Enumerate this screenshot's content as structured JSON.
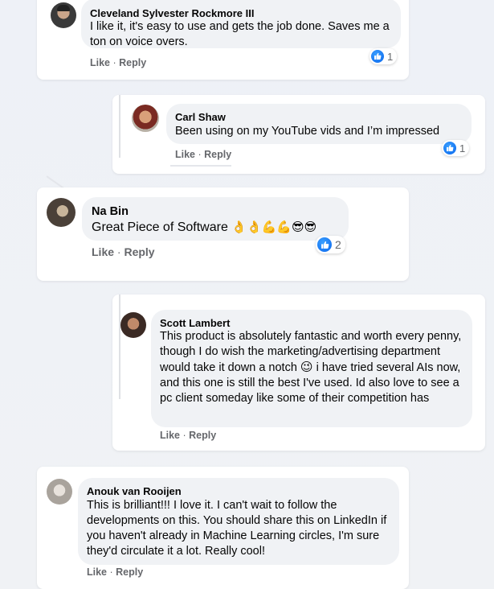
{
  "comments": [
    {
      "name": "Cleveland Sylvester Rockmore III",
      "text": "I like it, it's easy to use and gets the job done. Saves me a ton on voice overs.",
      "like_label": "Like",
      "reply_label": "Reply",
      "reaction_count": "1"
    },
    {
      "name": "Carl Shaw",
      "text": "Been using on my YouTube vids and I’m impressed",
      "like_label": "Like",
      "reply_label": "Reply",
      "reaction_count": "1"
    },
    {
      "name": "Na Bin",
      "text": "Great Piece of Software",
      "emojis": "👌👌💪💪😎😎",
      "like_label": "Like",
      "reply_label": "Reply",
      "reaction_count": "2"
    },
    {
      "name": "Scott Lambert",
      "text_before_emoji": "This product is absolutely fantastic and worth every penny, though I do wish the marketing/advertising department would take it down a notch",
      "emoji": "😉",
      "text_after_emoji": "i have tried several AIs now, and this one is still the best I've used. Id also love to see a pc client someday like some of their competition has",
      "like_label": "Like",
      "reply_label": "Reply"
    },
    {
      "name": "Anouk van Rooijen",
      "text": "This is brilliant!!! I love it. I can't wait to follow the developments on this. You should share this on LinkedIn if you haven't already in Machine Learning circles, I'm sure they'd circulate it a lot. Really cool!",
      "like_label": "Like",
      "reply_label": "Reply"
    }
  ],
  "separator": "·",
  "colors": {
    "like_blue": "#1877f2",
    "bubble": "#f0f2f5",
    "meta_text": "#65676b"
  },
  "icons": [
    "like-icon"
  ]
}
